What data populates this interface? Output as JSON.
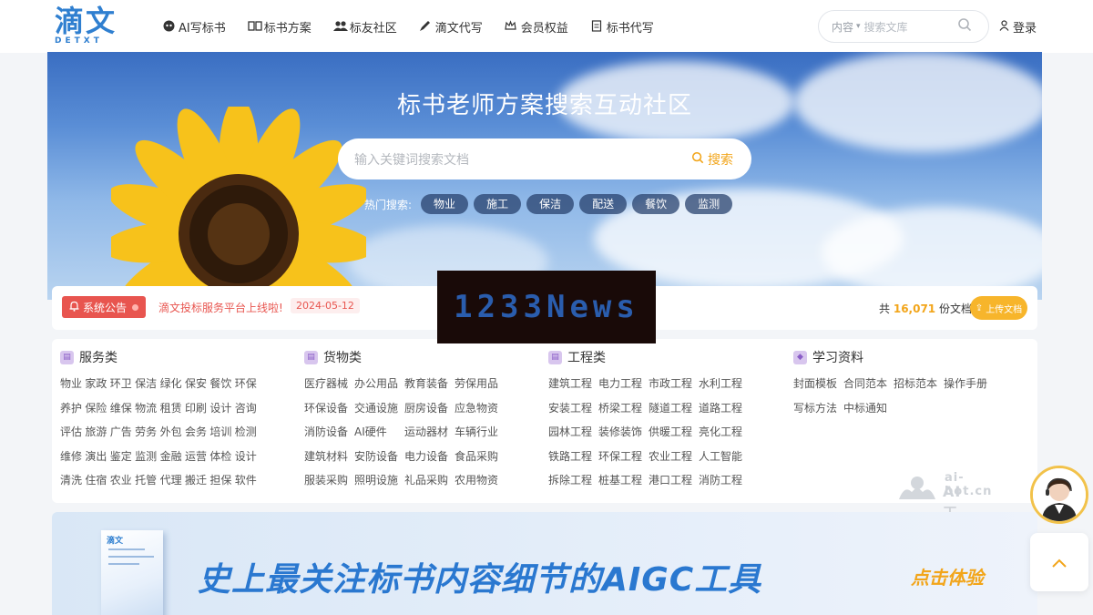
{
  "header": {
    "logo_cn": "滴文",
    "logo_en": "DETXT",
    "nav": [
      {
        "label": "AI写标书",
        "icon": "robot-icon"
      },
      {
        "label": "标书方案",
        "icon": "book-icon"
      },
      {
        "label": "标友社区",
        "icon": "users-icon"
      },
      {
        "label": "滴文代写",
        "icon": "pen-icon"
      },
      {
        "label": "会员权益",
        "icon": "crown-icon"
      },
      {
        "label": "标书代写",
        "icon": "document-icon"
      }
    ],
    "search": {
      "category": "内容",
      "placeholder": "搜索文库"
    },
    "login": "登录"
  },
  "banner": {
    "title": "标书老师方案搜索互动社区",
    "search_placeholder": "输入关键词搜索文档",
    "search_button": "搜索",
    "hot_label": "热门搜索:",
    "hot_tags": [
      "物业",
      "施工",
      "保洁",
      "配送",
      "餐饮",
      "监测"
    ]
  },
  "notice": {
    "badge": "系统公告",
    "text": "滴文投标服务平台上线啦!",
    "date": "2024-05-12",
    "count_prefix": "共",
    "count": "16,071",
    "count_suffix": "份文档",
    "upload": "上传文档"
  },
  "categories": [
    {
      "title": "服务类",
      "items": [
        "物业",
        "家政",
        "环卫",
        "保洁",
        "绿化",
        "保安",
        "餐饮",
        "环保",
        "养护",
        "保险",
        "维保",
        "物流",
        "租赁",
        "印刷",
        "设计",
        "咨询",
        "评估",
        "旅游",
        "广告",
        "劳务",
        "外包",
        "会务",
        "培训",
        "检测",
        "维修",
        "演出",
        "鉴定",
        "监测",
        "金融",
        "运营",
        "体检",
        "设计",
        "清洗",
        "住宿",
        "农业",
        "托管",
        "代理",
        "搬迁",
        "担保",
        "软件"
      ]
    },
    {
      "title": "货物类",
      "items": [
        "医疗器械",
        "办公用品",
        "教育装备",
        "劳保用品",
        "环保设备",
        "交通设施",
        "厨房设备",
        "应急物资",
        "消防设备",
        "AI硬件",
        "运动器材",
        "车辆行业",
        "建筑材料",
        "安防设备",
        "电力设备",
        "食品采购",
        "服装采购",
        "照明设施",
        "礼品采购",
        "农用物资"
      ]
    },
    {
      "title": "工程类",
      "items": [
        "建筑工程",
        "电力工程",
        "市政工程",
        "水利工程",
        "安装工程",
        "桥梁工程",
        "隧道工程",
        "道路工程",
        "园林工程",
        "装修装饰",
        "供暖工程",
        "亮化工程",
        "铁路工程",
        "环保工程",
        "农业工程",
        "人工智能",
        "拆除工程",
        "桩基工程",
        "港口工程",
        "消防工程"
      ]
    },
    {
      "title": "学习资料",
      "items": [
        "封面模板",
        "合同范本",
        "招标范本",
        "操作手册",
        "写标方法",
        "中标通知"
      ]
    }
  ],
  "watermark": {
    "line1": "ai-bot.cn",
    "line2": "AI工具集"
  },
  "promo": {
    "book_title": "滴文",
    "title": "史上最关注标书内容细节的AIGC工具",
    "cta": "点击体验"
  },
  "overlay": {
    "text": "1233News"
  },
  "colors": {
    "brand": "#2f7fd0",
    "accent": "#f2a51a",
    "notice_red": "#e8554f"
  }
}
